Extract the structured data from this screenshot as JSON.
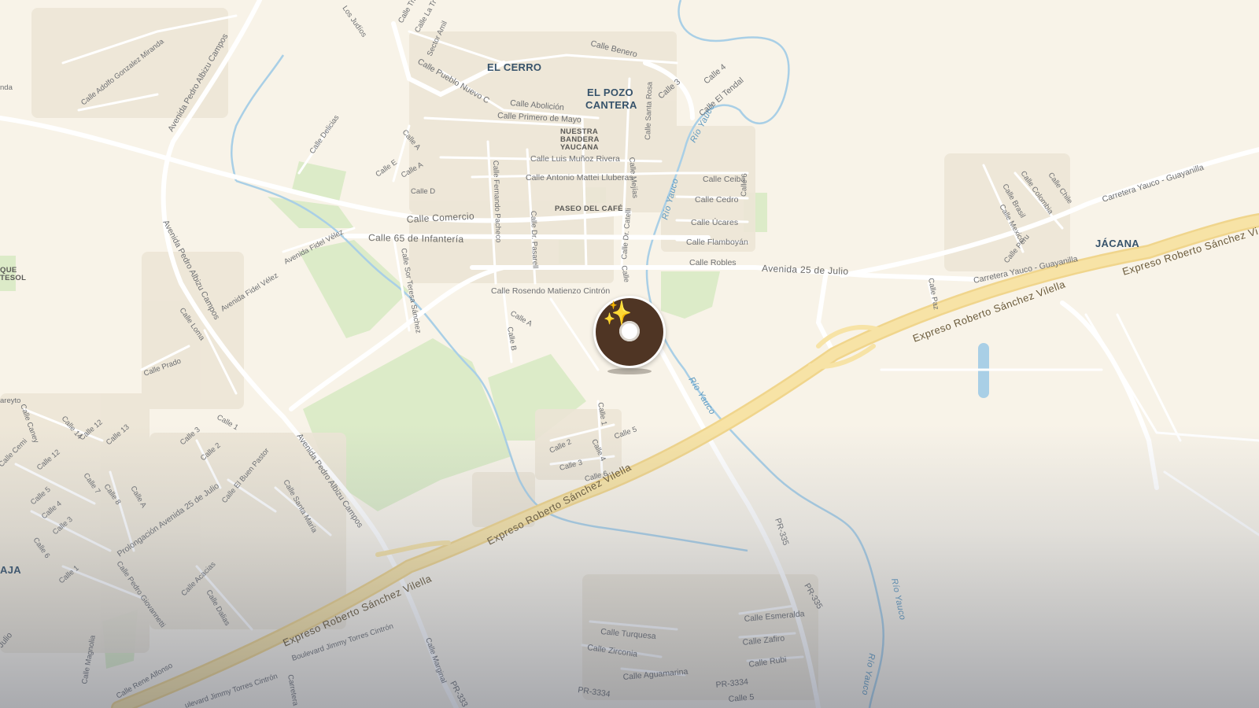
{
  "map": {
    "places": {
      "el_cerro": "EL CERRO",
      "el_pozo_1": "EL POZO",
      "el_pozo_2": "CANTERA",
      "jacana": "JÁCANA",
      "aja": "AJA",
      "que_1": "QUE",
      "que_2": "TESOL"
    },
    "pois": {
      "nuestra_1": "NUESTRA",
      "nuestra_2": "BANDERA",
      "nuestra_3": "YAUCANA",
      "paseo": "PASEO DEL CAFÉ"
    },
    "waters": {
      "rio_yauco_a": "Río Yauco",
      "rio_yauco_b": "Río Yauco",
      "rio_yauco_c": "Río Yauco",
      "rio_yauco_d": "Río Yauco",
      "rio_yauco_e": "Río Yauco"
    },
    "highways": {
      "expreso_ne": "Expreso Roberto Sánchez Vilella",
      "expreso_ne2": "Expreso Roberto Sánchez Vi",
      "expreso_mid": "Expreso Roberto Sánchez Vilella",
      "expreso_sw": "Expreso Roberto Sánchez Vilella"
    },
    "streets": {
      "avenida_25_julio": "Avenida 25 de Julio",
      "carretera_yauco_guayanilla": "Carretera Yauco - Guayanilla",
      "carretera_yauco_guayanilla_2": "Carretera Yauco - Guayanilla",
      "calle_comercio": "Calle Comercio",
      "calle_65": "Calle 65 de Infantería",
      "calle_robles": "Calle Robles",
      "calle_flamboyan": "Calle Flamboyán",
      "calle_ucares": "Calle Úcares",
      "calle_cedro": "Calle Cedro",
      "calle_ceiba": "Calle Ceiba",
      "calle_rosendo": "Calle Rosendo Matienzo Cintrón",
      "calle_antonio": "Calle Antonio Mattei Lluberas",
      "calle_luis": "Calle Luis Muñoz Rivera",
      "calle_primero": "Calle Primero de Mayo",
      "calle_abolicion": "Calle Abolición",
      "calle_benero": "Calle Benero",
      "calle_pueblo_nuevo": "Calle Pueblo Nuevo C",
      "calle_4": "Calle 4",
      "calle_3": "Calle 3",
      "calle_el_tendal": "Calle El Tendal",
      "calle_santa_rosa": "Calle Santa Rosa",
      "calle_mejias": "Calle Mejías",
      "calle_6": "Calle 6",
      "calle_dr_catelli": "Calle Dr. Catelli",
      "calle_dr_pasarell": "Calle Dr. Pasarell",
      "calle_fernando": "Calle Fernando Pacheco",
      "calle_sor_teresa": "Calle Sor Teresa Sánchez",
      "avenida_fidel": "Avenida Fidel Vélez",
      "avenida_fidel_2": "Avenida Fidel Vélez",
      "avenida_pedro_1": "Avenida Pedro Albizu Campos",
      "avenida_pedro_2": "Avenida Pedro Albizu Campos",
      "avenida_pedro_3": "Avenida Pedro Albizu Campos",
      "calle_adolfo": "Calle Adolfo Gonzalez Miranda",
      "calle_delicias": "Calle Delicias",
      "calle_a1": "Calle A",
      "calle_a2": "Calle A",
      "calle_e": "Calle E",
      "calle_d": "Calle D",
      "calle_a3": "Calle A",
      "calle_b": "Calle B",
      "calle_c": "Calle",
      "calle_los_judios": "Los Judíos",
      "calle_la_tr": "Calle La Tr",
      "sector_amil": "Sector Amil",
      "calle_trin": "Calle Trin",
      "calle_prado": "Calle Prado",
      "calle_loma": "Calle Loma",
      "calle_1": "Calle 1",
      "calle_1b": "Calle 1",
      "calle_2": "Calle 2",
      "calle_3b": "Calle 3",
      "calle_4b": "Calle 4",
      "calle_5": "Calle 5",
      "calle_6b": "Calle 6",
      "calle_paz": "Calle Paz",
      "calle_colombia": "Calle Colombia",
      "calle_chile": "Calle Chile",
      "calle_brasil": "Calle Brasil",
      "calle_mexico": "Calle Mexico",
      "calle_peru": "Calle Peru",
      "pr335_a": "PR-335",
      "pr335_b": "PR-335",
      "pr3334": "PR-3334",
      "pr3334b": "PR-3334",
      "pr333": "PR-333",
      "calle_turquesa": "Calle Turquesa",
      "calle_zirconia": "Calle Zirconia",
      "calle_aguamarina": "Calle Aguamarina",
      "calle_esmeralda": "Calle Esmeralda",
      "calle_zafiro": "Calle Zafiro",
      "calle_rubi": "Calle Rubi",
      "calle_5b": "Calle 5",
      "boulevard_jimmy": "Boulevard Jimmy Torres Cintrón",
      "boulevard_jimmy_2": "ulevard Jimmy Torres Cintrón",
      "calle_marginal": "Calle Marginal",
      "calle_rene": "Calle Rene Alfonso",
      "calle_magnolia": "Calle Magnolia",
      "calle_dalias": "Calle Dalias",
      "calle_acacias": "Calle Acacias",
      "calle_pedro_g": "Calle Pedro Giovannetti",
      "prolongacion": "Prolongación Avenida 25 de Julio",
      "calle_el_buen_pastor": "Calle El Buen Pastor",
      "calle_santa_maria": "Calle Santa María",
      "calle_a4": "Calle A",
      "calle_14": "Calle 14",
      "calle_12": "Calle 12",
      "calle_13": "Calle 13",
      "calle_12b": "Calle 12",
      "calle_cemi": "Calle Cemi",
      "calle_caney": "Calle Caney",
      "calle_5c": "Calle 5",
      "calle_4c": "Calle 4",
      "calle_3c": "Calle 3",
      "calle_6c": "Calle 6",
      "calle_1c": "Calle 1",
      "calle_7": "Calle 7",
      "calle_8": "Calle 8",
      "calle_3d": "Calle 3",
      "calle_2b": "Calle 2",
      "areyto": "areyto",
      "julio": "Julio",
      "nda": "nda",
      "carretera_s": "Carretera"
    },
    "marker": {
      "icon": "coffee-shop-sparkle-icon",
      "color": "#4f3524",
      "accent": "#f3c24a"
    }
  }
}
